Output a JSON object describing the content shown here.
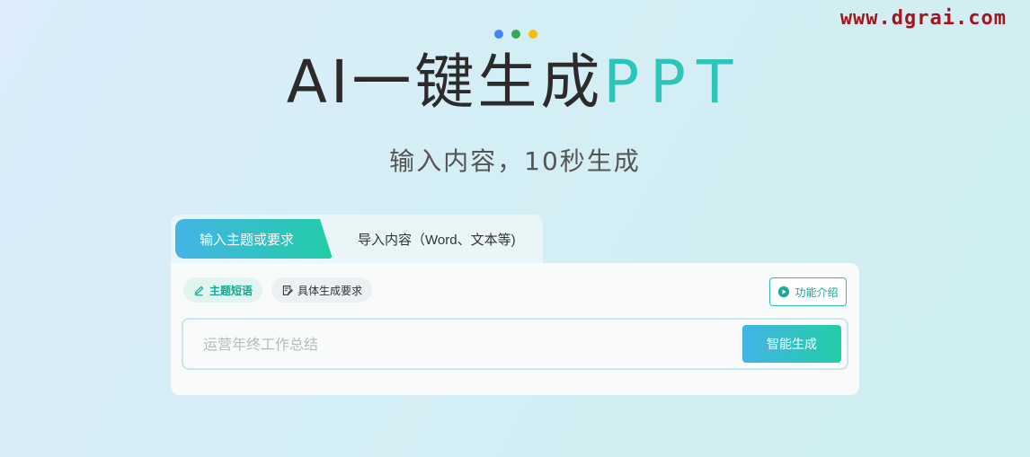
{
  "watermark": "www.dgrai.com",
  "dots": [
    "#4286f4",
    "#34a853",
    "#fbbc05"
  ],
  "hero": {
    "title_main": "AI一键生成",
    "title_accent": "PPT",
    "subtitle": "输入内容，10秒生成"
  },
  "colors": {
    "accent": "#2dc5b8",
    "gradient_start": "#44b4e6",
    "gradient_end": "#22cda6"
  },
  "tabs": [
    {
      "label": "输入主题或要求",
      "active": true
    },
    {
      "label": "导入内容（Word、文本等)",
      "active": false
    }
  ],
  "chips": [
    {
      "label": "主题短语",
      "icon": "pencil-icon",
      "active": true
    },
    {
      "label": "具体生成要求",
      "icon": "note-edit-icon",
      "active": false
    }
  ],
  "feature_intro": {
    "label": "功能介绍",
    "icon": "play-circle-icon"
  },
  "input": {
    "placeholder": "运营年终工作总结",
    "value": ""
  },
  "generate_button": {
    "label": "智能生成"
  }
}
